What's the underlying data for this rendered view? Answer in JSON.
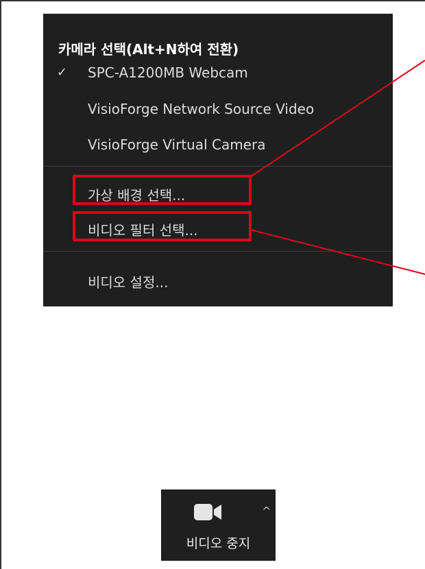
{
  "camera_menu": {
    "header": "카메라 선택(Alt+N하여 전환)",
    "check_icon": "checkmark-icon",
    "cameras": [
      {
        "label": "SPC-A1200MB Webcam",
        "selected": true
      },
      {
        "label": "VisioForge Network Source Video",
        "selected": false
      },
      {
        "label": "VisioForge Virtual Camera",
        "selected": false
      }
    ],
    "virtual_background": "가상 배경 선택...",
    "video_filter": "비디오 필터 선택...",
    "video_settings": "비디오 설정..."
  },
  "annotations": {
    "highlight_color": "#e0001b"
  },
  "toolbar": {
    "stop_video_label": "비디오 중지",
    "camera_icon": "video-camera-icon",
    "caret_icon": "chevron-up-icon"
  }
}
